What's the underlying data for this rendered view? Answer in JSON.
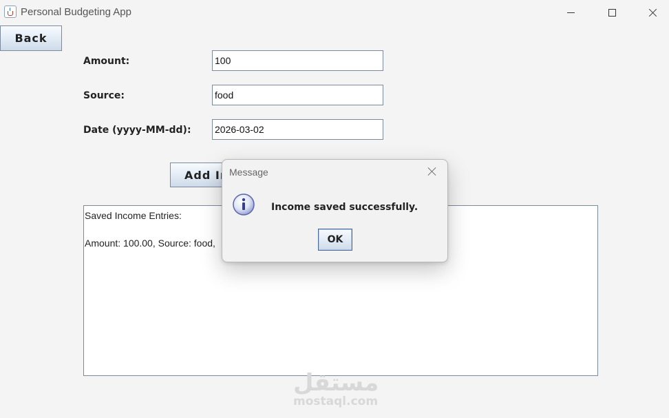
{
  "window": {
    "title": "Personal Budgeting App",
    "icon": "java-cup-icon",
    "controls": [
      "minimize-icon",
      "maximize-icon",
      "close-icon"
    ]
  },
  "nav": {
    "back_label": "Back"
  },
  "form": {
    "amount_label": "Amount:",
    "amount_value": "100",
    "source_label": "Source:",
    "source_value": "food",
    "date_label": "Date (yyyy-MM-dd):",
    "date_value": "2026-03-02",
    "add_button_label": "Add Income"
  },
  "output": {
    "line1": "Saved Income Entries:",
    "line2": "Amount: 100.00, Source: food,"
  },
  "dialog": {
    "title": "Message",
    "icon": "info-icon",
    "message": "Income saved successfully.",
    "ok_label": "OK"
  },
  "watermark": {
    "arabic": "مستقل",
    "latin": "mostaql.com"
  },
  "colors": {
    "background": "#f4f4f4",
    "button_gradient_top": "#f8fbff",
    "button_gradient_bottom": "#cfdbe9",
    "border": "#7a8a9c"
  }
}
